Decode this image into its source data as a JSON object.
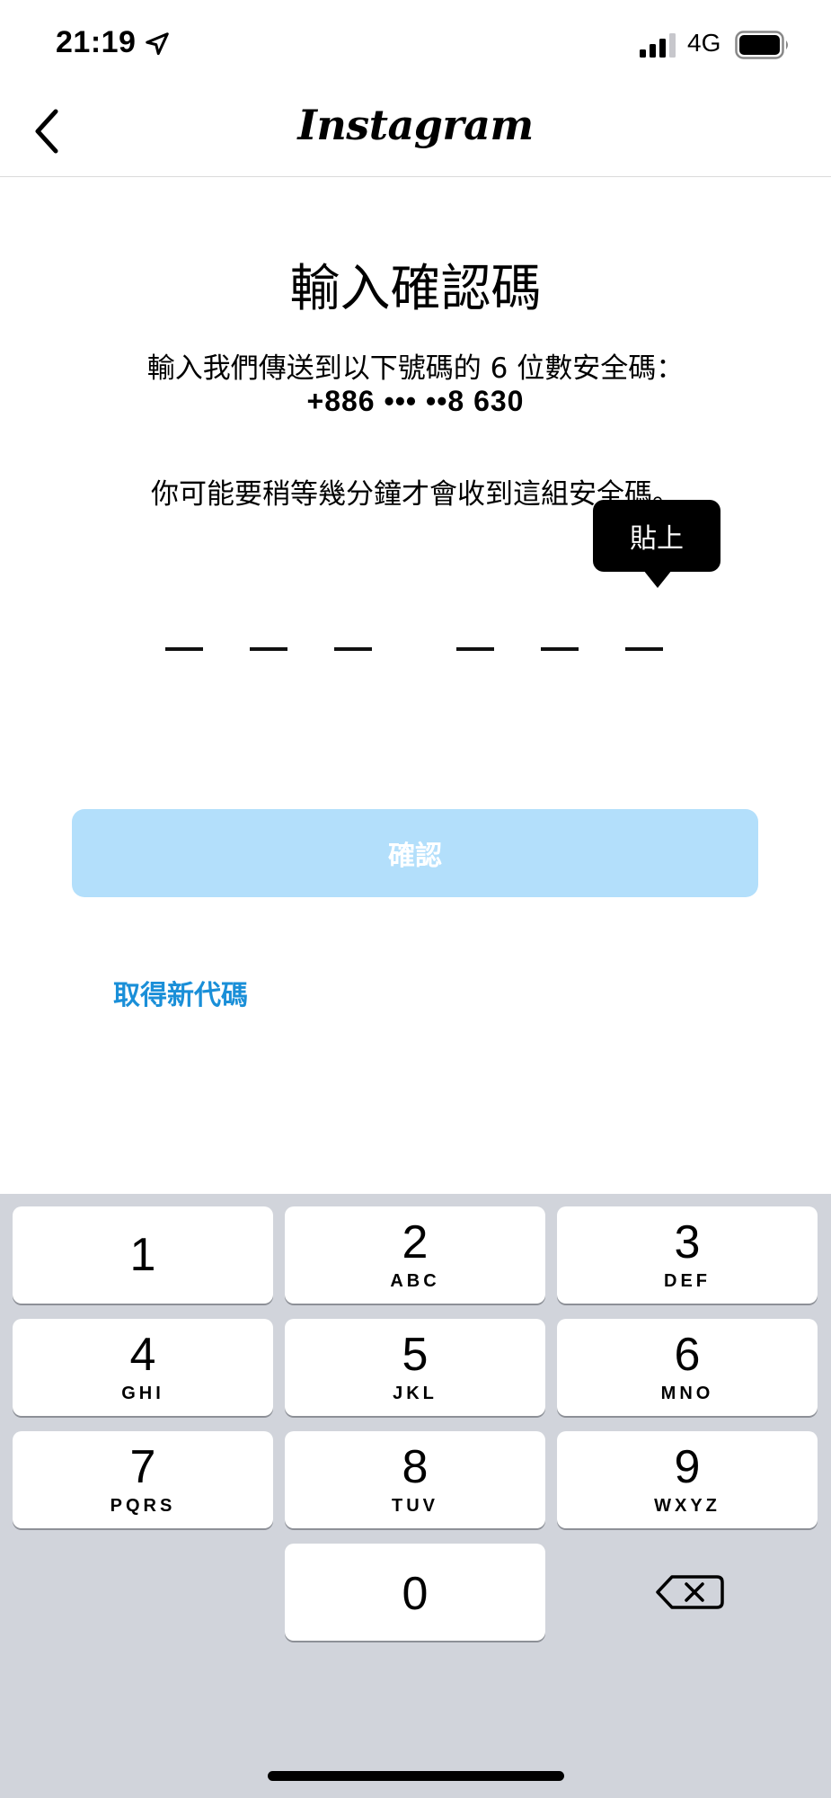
{
  "status_bar": {
    "time": "21:19",
    "network": "4G"
  },
  "header": {
    "brand": "Instagram"
  },
  "main": {
    "title": "輸入確認碼",
    "description": "輸入我們傳送到以下號碼的 6 位數安全碼：",
    "phone": "+886 ••• ••8 630",
    "wait_notice": "你可能要稍等幾分鐘才會收到這組安全碼。",
    "paste_tooltip": "貼上",
    "confirm_label": "確認",
    "resend_label": "取得新代碼"
  },
  "keyboard": {
    "keys": [
      {
        "digit": "1",
        "letters": ""
      },
      {
        "digit": "2",
        "letters": "ABC"
      },
      {
        "digit": "3",
        "letters": "DEF"
      },
      {
        "digit": "4",
        "letters": "GHI"
      },
      {
        "digit": "5",
        "letters": "JKL"
      },
      {
        "digit": "6",
        "letters": "MNO"
      },
      {
        "digit": "7",
        "letters": "PQRS"
      },
      {
        "digit": "8",
        "letters": "TUV"
      },
      {
        "digit": "9",
        "letters": "WXYZ"
      },
      {
        "digit": "0",
        "letters": ""
      }
    ]
  },
  "colors": {
    "accent": "#1a8fd8",
    "button_disabled": "#b3dffb",
    "keyboard_bg": "#d1d4db"
  }
}
